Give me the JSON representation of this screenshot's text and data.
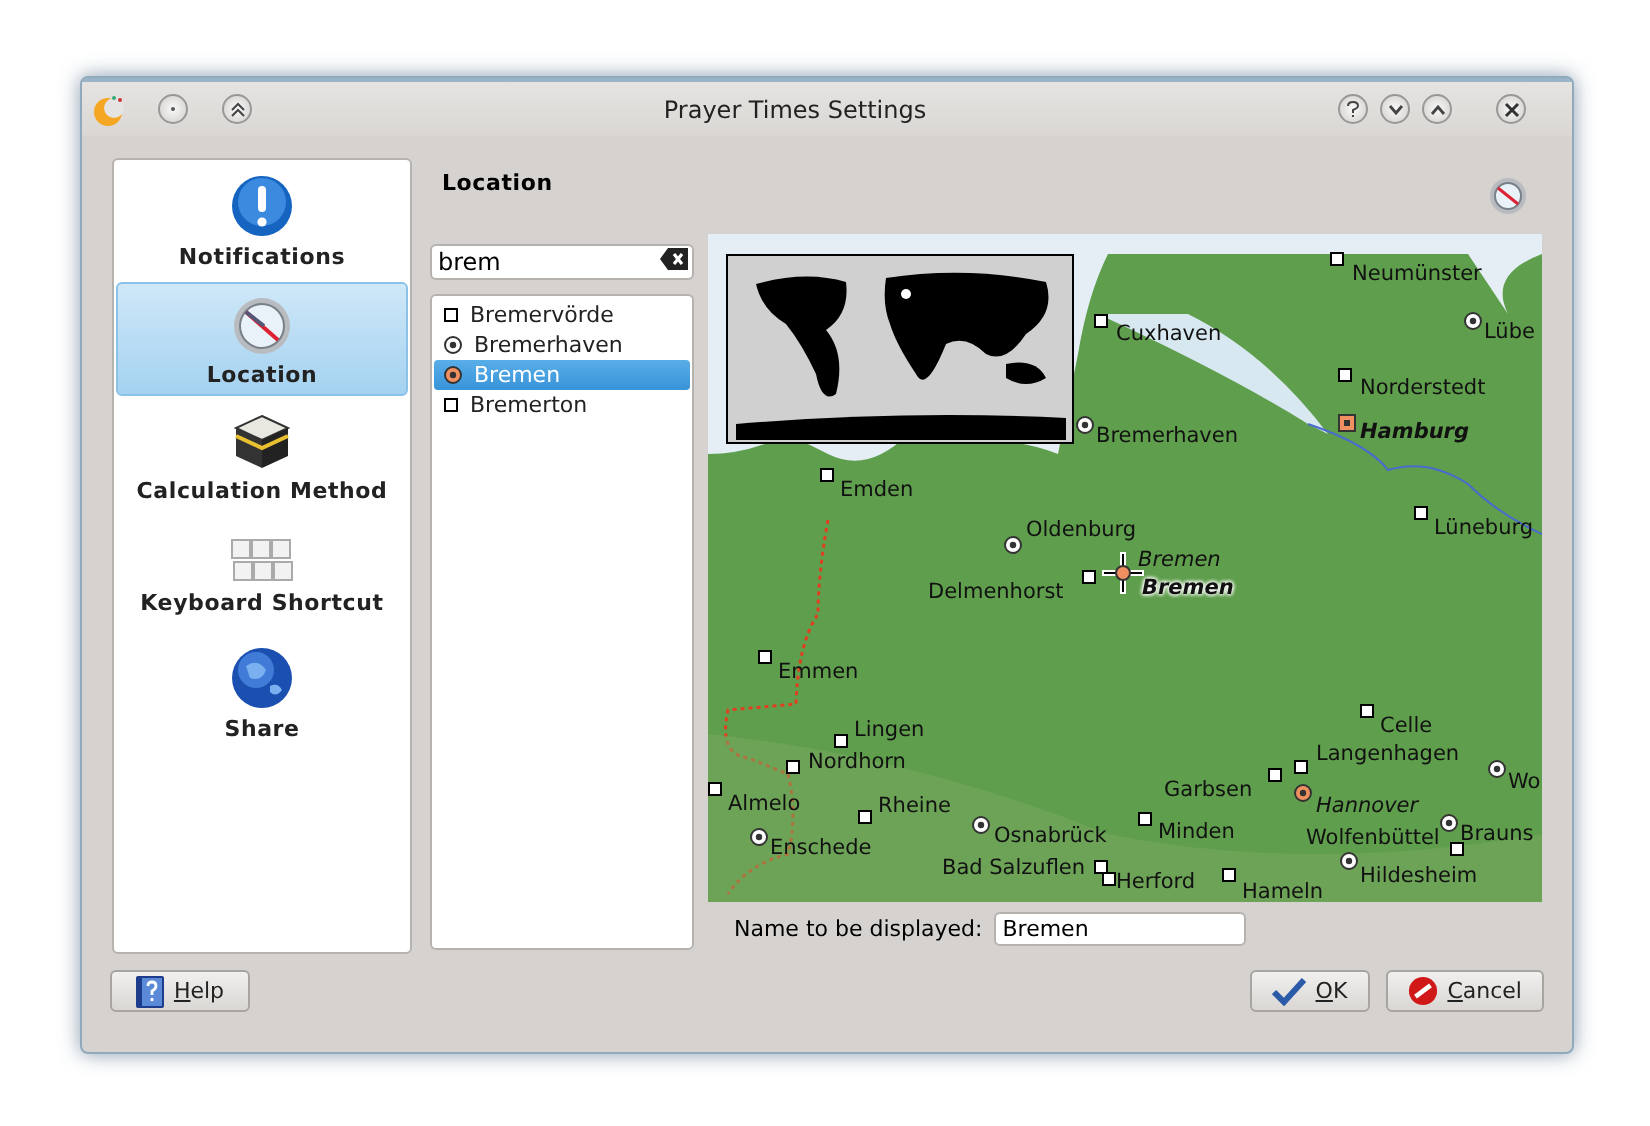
{
  "window": {
    "title": "Prayer Times Settings"
  },
  "sidebar": {
    "items": [
      {
        "label": "Notifications",
        "selected": false
      },
      {
        "label": "Location",
        "selected": true
      },
      {
        "label": "Calculation Method",
        "selected": false
      },
      {
        "label": "Keyboard Shortcut",
        "selected": false
      },
      {
        "label": "Share",
        "selected": false
      }
    ]
  },
  "page": {
    "title": "Location"
  },
  "search": {
    "value": "brem"
  },
  "results": [
    {
      "label": "Bremervörde",
      "kind": "town",
      "selected": false
    },
    {
      "label": "Bremerhaven",
      "kind": "city",
      "selected": false
    },
    {
      "label": "Bremen",
      "kind": "regional",
      "selected": true
    },
    {
      "label": "Bremerton",
      "kind": "town",
      "selected": false
    }
  ],
  "map": {
    "labels": [
      {
        "text": "Neumünster",
        "kind": "town"
      },
      {
        "text": "Cuxhaven",
        "kind": "town"
      },
      {
        "text": "Lübe",
        "kind": "city"
      },
      {
        "text": "Norderstedt",
        "kind": "town"
      },
      {
        "text": "Bremerhaven",
        "kind": "city"
      },
      {
        "text": "Hamburg",
        "kind": "capital"
      },
      {
        "text": "Emden",
        "kind": "town"
      },
      {
        "text": "Oldenburg",
        "kind": "city"
      },
      {
        "text": "Lüneburg",
        "kind": "town"
      },
      {
        "text": "Bremen",
        "kind": "search"
      },
      {
        "text": "Delmenhorst",
        "kind": "town"
      },
      {
        "text": "Bremen",
        "kind": "selected"
      },
      {
        "text": "Emmen",
        "kind": "town"
      },
      {
        "text": "Lingen",
        "kind": "town"
      },
      {
        "text": "Celle",
        "kind": "town"
      },
      {
        "text": "Nordhorn",
        "kind": "town"
      },
      {
        "text": "Langenhagen",
        "kind": "town"
      },
      {
        "text": "Almelo",
        "kind": "town"
      },
      {
        "text": "Rheine",
        "kind": "town"
      },
      {
        "text": "Garbsen",
        "kind": "town"
      },
      {
        "text": "Hannover",
        "kind": "regional"
      },
      {
        "text": "Wo",
        "kind": "city"
      },
      {
        "text": "Enschede",
        "kind": "city"
      },
      {
        "text": "Osnabrück",
        "kind": "city"
      },
      {
        "text": "Minden",
        "kind": "town"
      },
      {
        "text": "Wolfenbüttel",
        "kind": "town"
      },
      {
        "text": "Brauns",
        "kind": "city"
      },
      {
        "text": "Bad Salzuflen",
        "kind": "town"
      },
      {
        "text": "Herford",
        "kind": "town"
      },
      {
        "text": "Hameln",
        "kind": "town"
      },
      {
        "text": "Hildesheim",
        "kind": "city"
      }
    ]
  },
  "display_name": {
    "label": "Name to be displayed:",
    "value": "Bremen"
  },
  "buttons": [
    {
      "label": "Help"
    },
    {
      "label": "OK"
    },
    {
      "label": "Cancel"
    }
  ]
}
